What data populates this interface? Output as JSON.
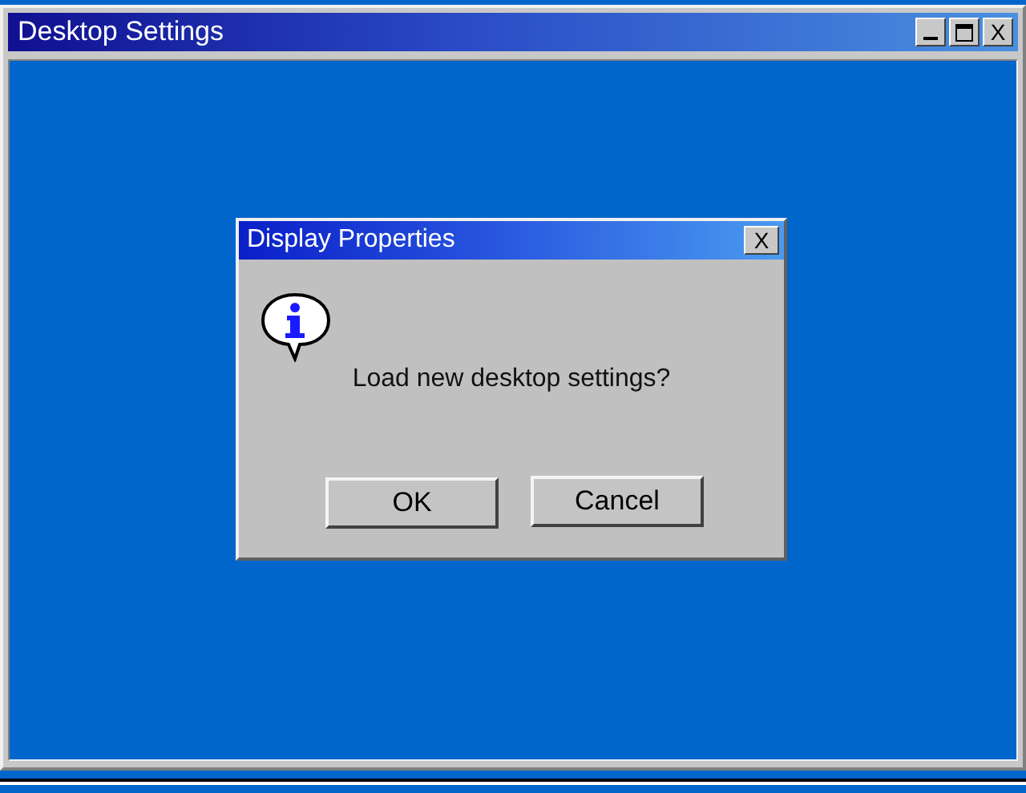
{
  "window": {
    "title": "Desktop Settings",
    "close_label": "X"
  },
  "dialog": {
    "title": "Display Properties",
    "close_label": "X",
    "message": "Load new desktop settings?",
    "buttons": [
      "OK",
      "Cancel"
    ]
  }
}
